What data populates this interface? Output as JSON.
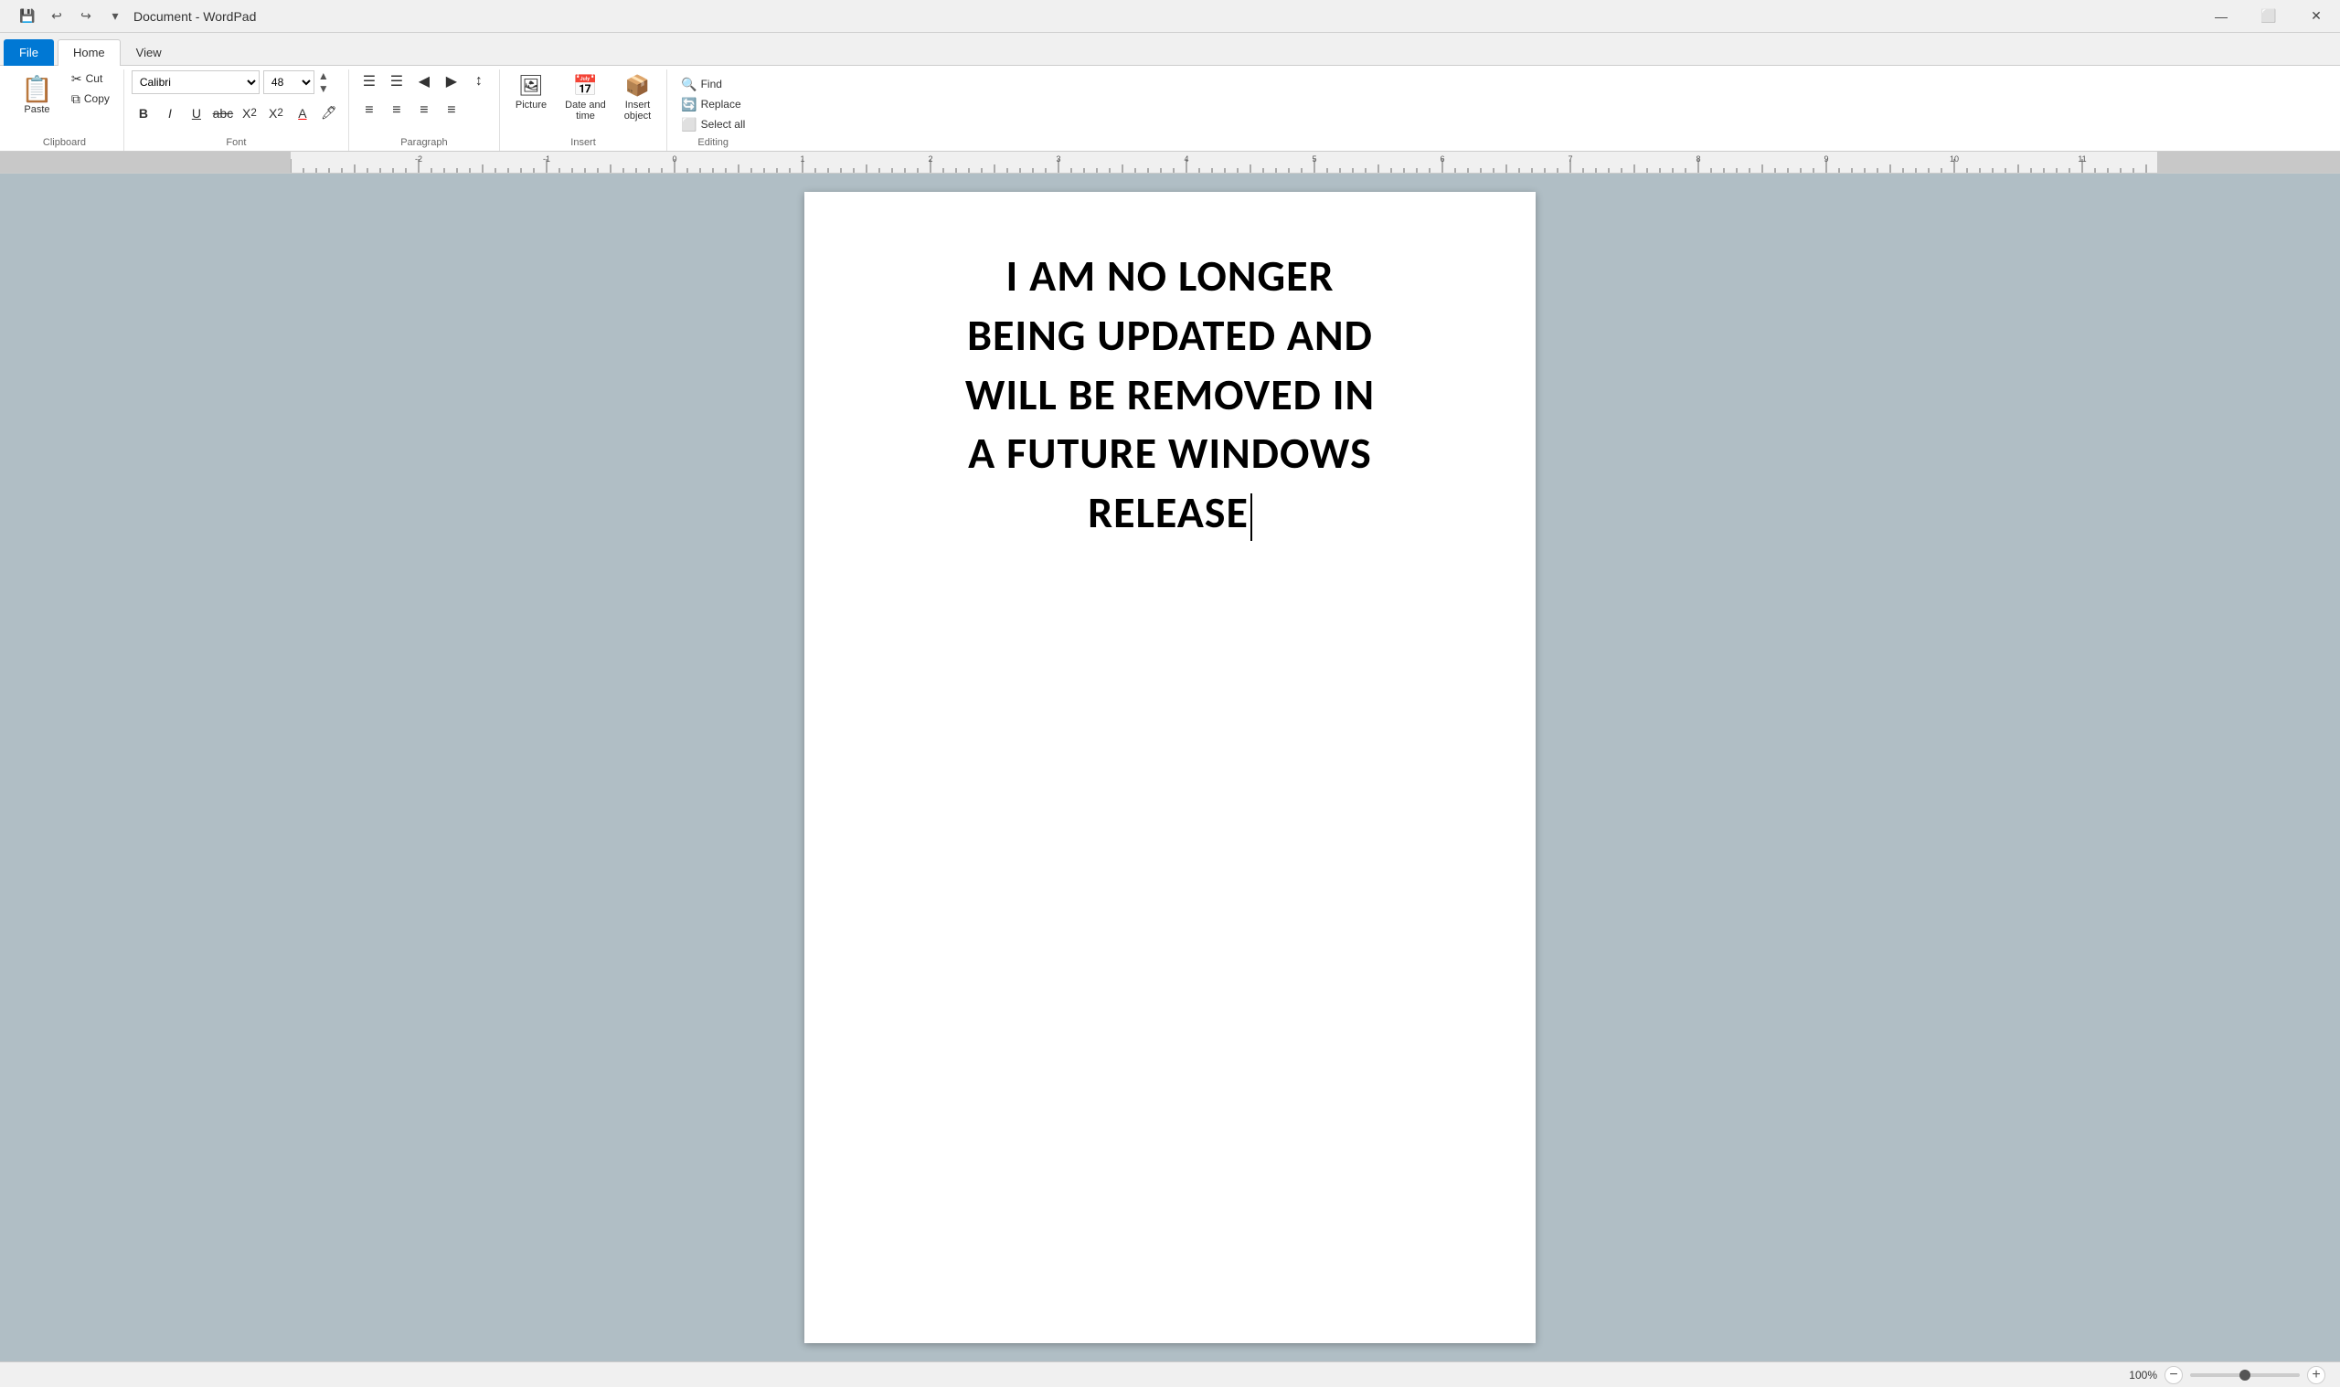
{
  "titleBar": {
    "title": "Document - WordPad",
    "qat": {
      "save": "💾",
      "undo": "↩",
      "redo": "↪",
      "dropdown": "▾"
    },
    "controls": {
      "minimize": "—",
      "maximize": "⬜",
      "close": "✕"
    }
  },
  "tabs": [
    {
      "id": "file",
      "label": "File",
      "active": false
    },
    {
      "id": "home",
      "label": "Home",
      "active": true
    },
    {
      "id": "view",
      "label": "View",
      "active": false
    }
  ],
  "ribbon": {
    "groups": {
      "clipboard": {
        "label": "Clipboard",
        "paste": "Paste",
        "cut": "Cut",
        "copy": "Copy"
      },
      "font": {
        "label": "Font",
        "name": "Calibri",
        "size": "48",
        "bold": "B",
        "italic": "I",
        "underline": "U",
        "strikethrough": "abc",
        "subscript": "X₂",
        "superscript": "X²",
        "color": "A",
        "highlight": "🖊"
      },
      "paragraph": {
        "label": "Paragraph",
        "list_unordered": "≡",
        "list_ordered": "≡",
        "indent_decrease": "←≡",
        "indent_increase": "→≡",
        "align_left": "≡",
        "align_center": "≡",
        "align_right": "≡",
        "align_justify": "≡",
        "line_spacing": "↕"
      },
      "insert": {
        "label": "Insert",
        "picture": "Picture",
        "datetime": "Date and\ntime",
        "object": "Insert\nobject"
      },
      "editing": {
        "label": "Editing",
        "find": "Find",
        "replace": "Replace",
        "select_all": "Select all"
      }
    }
  },
  "document": {
    "text": "I AM NO LONGER BEING UPDATED AND WILL BE REMOVED IN A FUTURE WINDOWS RELEASE"
  },
  "statusBar": {
    "zoom_level": "100%",
    "zoom_minus": "−",
    "zoom_plus": "+"
  }
}
